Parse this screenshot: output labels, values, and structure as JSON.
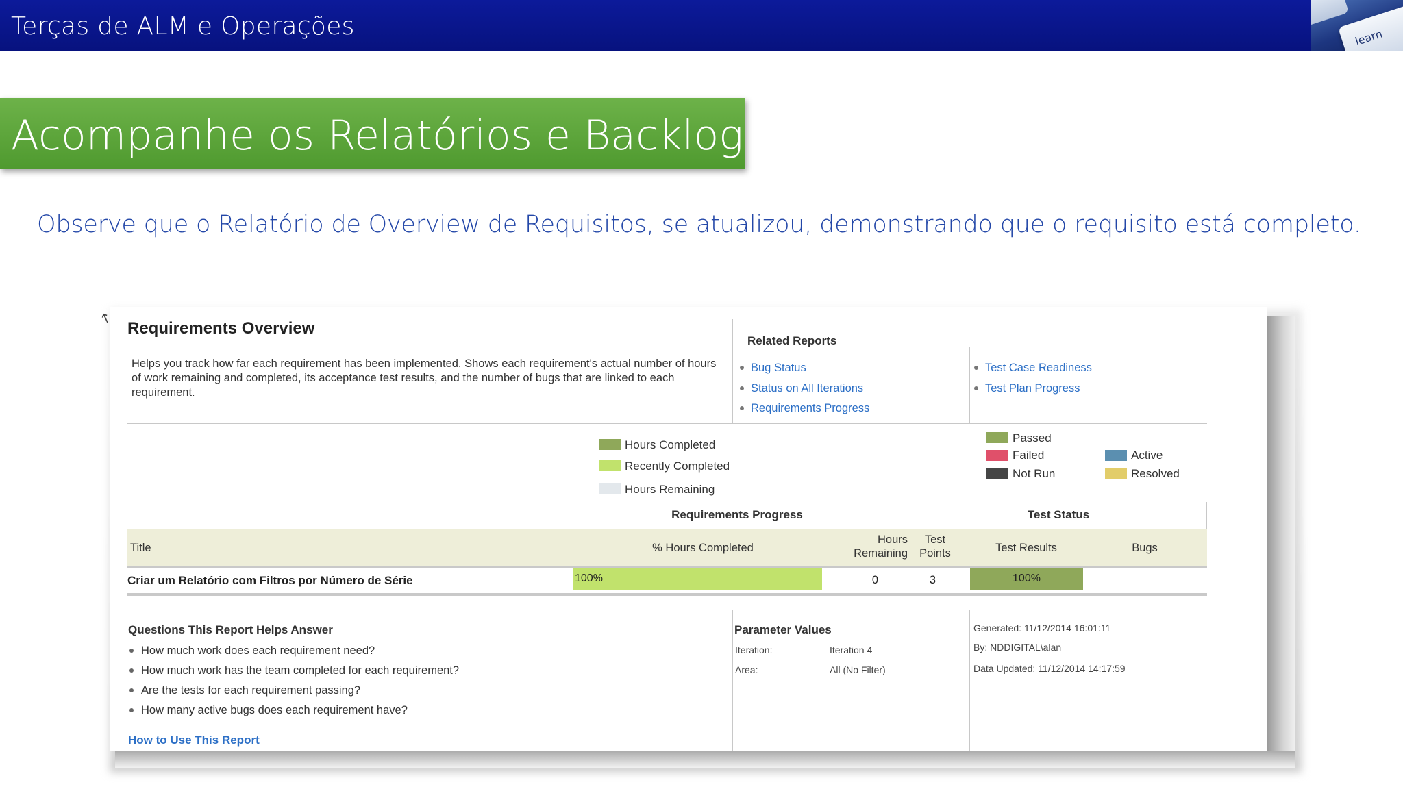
{
  "slide": {
    "header_title": "Terças de ALM e Operações",
    "key_label": "learn",
    "section_title": "Acompanhe os Relatórios e Backlog",
    "subtitle": "Observe que o Relatório de Overview de Requisitos, se atualizou, demonstrando que o requisito está completo."
  },
  "report": {
    "title": "Requirements Overview",
    "description": "Helps you track how far each requirement has been implemented. Shows each requirement's actual number of hours of work remaining and completed, its acceptance test results, and the number of bugs that are linked to each requirement.",
    "related_reports": {
      "heading": "Related Reports",
      "left": [
        "Bug Status",
        "Status on All Iterations",
        "Requirements Progress"
      ],
      "right": [
        "Test Case Readiness",
        "Test Plan Progress"
      ]
    },
    "legend_hours": [
      {
        "label": "Hours Completed",
        "color": "#8fa85a"
      },
      {
        "label": "Recently Completed",
        "color": "#c1e26c"
      },
      {
        "label": "Hours Remaining",
        "color": "#e3e8ec"
      }
    ],
    "legend_tests": [
      {
        "label": "Passed",
        "color": "#8fa85a"
      },
      {
        "label": "Failed",
        "color": "#e0506a"
      },
      {
        "label": "Not Run",
        "color": "#454545"
      },
      {
        "label": "Active",
        "color": "#5b8fb0"
      },
      {
        "label": "Resolved",
        "color": "#e2cd6a"
      }
    ],
    "groups": {
      "progress": "Requirements Progress",
      "test_status": "Test Status"
    },
    "columns": {
      "title": "Title",
      "pct_hours": "% Hours Completed",
      "hours_remaining": "Hours Remaining",
      "test_points": "Test Points",
      "test_results": "Test Results",
      "bugs": "Bugs"
    },
    "rows": [
      {
        "title": "Criar um Relatório com Filtros por Número de Série",
        "pct_hours_label": "100%",
        "pct_hours": 1.0,
        "hours_remaining": "0",
        "test_points": "3",
        "test_results_label": "100%",
        "test_passed": 1.0,
        "bugs": ""
      }
    ],
    "questions": {
      "heading": "Questions This Report Helps Answer",
      "items": [
        "How much work does each requirement need?",
        "How much work has the team completed for each requirement?",
        "Are the tests for each requirement passing?",
        "How many active bugs does each requirement have?"
      ],
      "link": "How to Use This Report"
    },
    "parameters": {
      "heading": "Parameter Values",
      "iteration_label": "Iteration:",
      "iteration_value": "Iteration 4",
      "area_label": "Area:",
      "area_value": "All (No Filter)"
    },
    "generated": {
      "generated": "Generated: 11/12/2014 16:01:11",
      "by": "By: NDDIGITAL\\alan",
      "data_updated": "Data Updated: 11/12/2014 14:17:59"
    }
  }
}
